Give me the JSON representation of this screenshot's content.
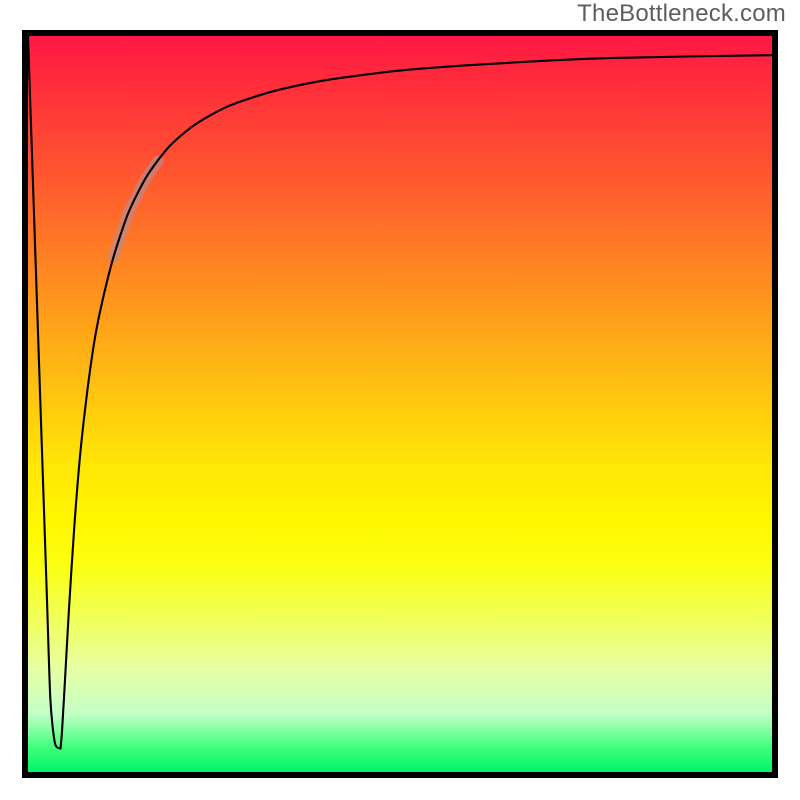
{
  "watermark": "TheBottleneck.com",
  "colors": {
    "frame": "#000000",
    "watermark_text": "#5d5d5d",
    "highlight_stroke": "#bb8b8b",
    "curve_stroke": "#000000",
    "gradient_top": "#ff1844",
    "gradient_bottom": "#00f36a"
  },
  "chart_data": {
    "type": "line",
    "title": "",
    "xlabel": "",
    "ylabel": "",
    "xlim": [
      0,
      100
    ],
    "ylim": [
      0,
      100
    ],
    "x": [
      0,
      0.5,
      1.5,
      2.5,
      3.0,
      3.6,
      4.3,
      4.4,
      4.6,
      5.0,
      5.5,
      6.2,
      7.0,
      8.0,
      9.0,
      10.0,
      11.5,
      13.5,
      16.0,
      19.0,
      22.5,
      27.0,
      33.0,
      40.0,
      50.0,
      62.0,
      78.0,
      100.0
    ],
    "values": [
      100,
      85,
      55,
      25,
      10,
      4,
      3.2,
      3.5,
      6,
      13,
      22,
      33,
      43,
      52,
      59,
      64,
      70,
      76,
      81,
      85,
      88,
      90.5,
      92.5,
      94,
      95.3,
      96.2,
      97,
      97.4
    ],
    "highlight_range_x": [
      11.5,
      17.5
    ],
    "notes": "Curve starts at top-left, dips sharply to a narrow minimum near x≈4.3, y≈3, then rises asymptotically toward ~97 at the right edge. A short faded mauve highlight overlays the curve roughly over x 11.5–17.5."
  }
}
